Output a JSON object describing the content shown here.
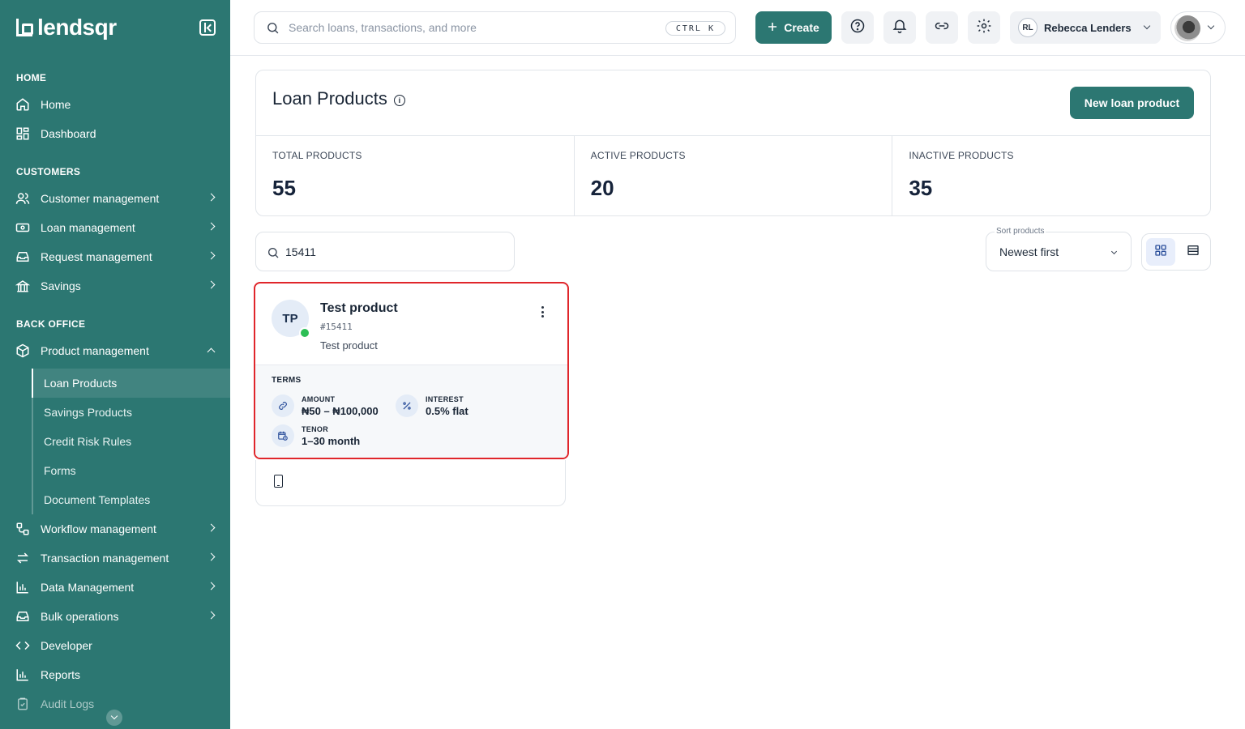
{
  "brand": {
    "name": "lendsqr"
  },
  "sidebar": {
    "sections": {
      "home": "HOME",
      "customers": "CUSTOMERS",
      "back_office": "BACK OFFICE"
    },
    "items": {
      "home": "Home",
      "dashboard": "Dashboard",
      "customer_management": "Customer management",
      "loan_management": "Loan management",
      "request_management": "Request management",
      "savings": "Savings",
      "product_management": "Product management",
      "workflow_management": "Workflow management",
      "transaction_management": "Transaction management",
      "data_management": "Data Management",
      "bulk_operations": "Bulk operations",
      "developer": "Developer",
      "reports": "Reports",
      "audit_logs": "Audit Logs"
    },
    "product_sub": [
      "Loan Products",
      "Savings Products",
      "Credit Risk Rules",
      "Forms",
      "Document Templates"
    ],
    "active_sub": "Loan Products"
  },
  "topbar": {
    "search_placeholder": "Search loans, transactions, and more",
    "shortcut": "CTRL K",
    "create_label": "Create",
    "org_initials": "RL",
    "org_name": "Rebecca Lenders"
  },
  "page": {
    "title": "Loan Products",
    "new_button": "New loan product",
    "stats": [
      {
        "label": "TOTAL PRODUCTS",
        "value": "55"
      },
      {
        "label": "ACTIVE PRODUCTS",
        "value": "20"
      },
      {
        "label": "INACTIVE PRODUCTS",
        "value": "35"
      }
    ],
    "filter_value": "15411",
    "sort": {
      "caption": "Sort products",
      "value": "Newest first"
    }
  },
  "product": {
    "initials": "TP",
    "name": "Test product",
    "id": "#15411",
    "description": "Test product",
    "status_color": "#2dbe55",
    "terms_label": "TERMS",
    "amount_label": "AMOUNT",
    "amount_value": "₦50 – ₦100,000",
    "interest_label": "INTEREST",
    "interest_value": "0.5% flat",
    "tenor_label": "TENOR",
    "tenor_value": "1–30 month"
  },
  "colors": {
    "brand": "#2c7772",
    "highlight": "#e0262b"
  }
}
